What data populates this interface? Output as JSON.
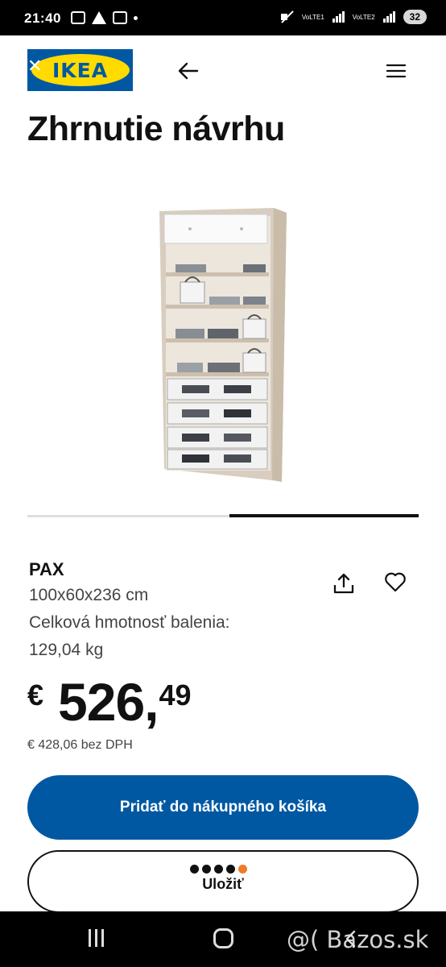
{
  "status_bar": {
    "time": "21:40",
    "net1": "VoLTE1",
    "net2": "VoLTE2",
    "battery": "32"
  },
  "header": {
    "logo_text": "IKEA",
    "back_icon": "arrow-left-icon",
    "menu_icon": "hamburger-menu-icon"
  },
  "page": {
    "title": "Zhrnutie návrhu"
  },
  "product": {
    "name": "PAX",
    "dimensions": "100x60x236 cm",
    "weight_label": "Celková hmotnosť balenia:",
    "weight": "129,04 kg",
    "share_icon": "share-icon",
    "favorite_icon": "heart-icon"
  },
  "price": {
    "currency": "€",
    "integer": "526",
    "comma": ",",
    "decimal": "49",
    "excl_vat": "€ 428,06 bez DPH"
  },
  "actions": {
    "add_to_cart": "Pridať do nákupného košíka",
    "save": "Uložiť"
  },
  "nav": {
    "watermark": "@( Bazos.sk"
  },
  "colors": {
    "ikea_blue": "#0058a3",
    "ikea_yellow": "#ffdb00"
  }
}
